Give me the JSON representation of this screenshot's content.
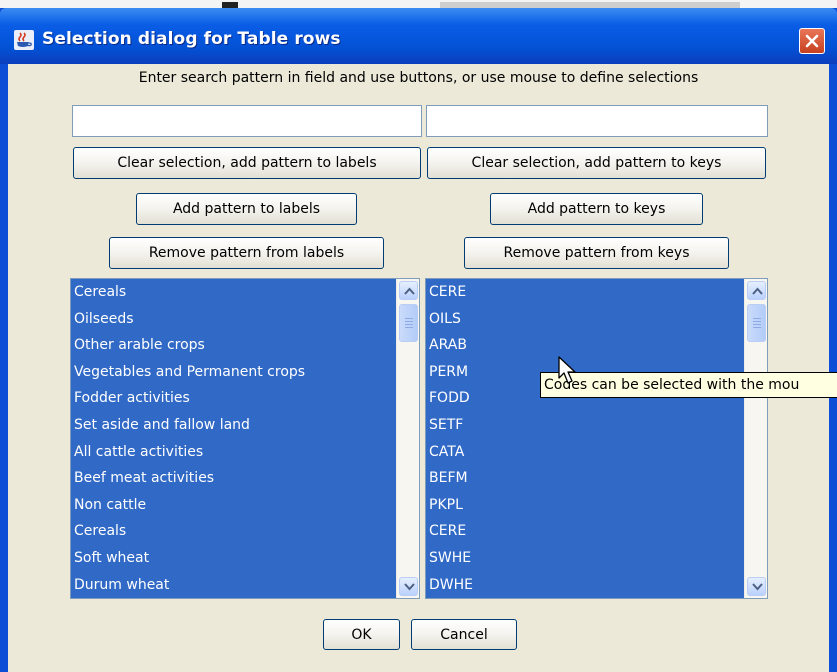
{
  "window": {
    "title": "Selection dialog for Table rows",
    "icon": "java-cup-icon",
    "close_icon": "close-icon"
  },
  "instruction": "Enter search pattern in field and use buttons, or use mouse to define selections",
  "left": {
    "search_value": "",
    "clear_add_label": "Clear selection, add pattern to labels",
    "add_label": "Add pattern to labels",
    "remove_label": "Remove pattern from labels",
    "items": [
      "Cereals",
      "Oilseeds",
      "Other arable crops",
      "Vegetables and Permanent crops",
      "Fodder activities",
      "Set aside and fallow land",
      "All cattle activities",
      "Beef meat activities",
      "Non cattle",
      "Cereals",
      "Soft wheat",
      "Durum wheat"
    ]
  },
  "right": {
    "search_value": "",
    "clear_add_label": "Clear selection, add pattern to keys",
    "add_label": "Add pattern to keys",
    "remove_label": "Remove pattern from keys",
    "items": [
      "CERE",
      "OILS",
      "ARAB",
      "PERM",
      "FODD",
      "SETF",
      "CATA",
      "BEFM",
      "PKPL",
      "CERE",
      "SWHE",
      "DWHE"
    ]
  },
  "tooltip": "Codes can be selected with the mou",
  "footer": {
    "ok_label": "OK",
    "cancel_label": "Cancel"
  },
  "colors": {
    "titlebar": "#0352d6",
    "selection": "#3169c6",
    "dialog_bg": "#ece9d8",
    "tooltip_bg": "#ffffe1",
    "close_button": "#d95d3a"
  }
}
